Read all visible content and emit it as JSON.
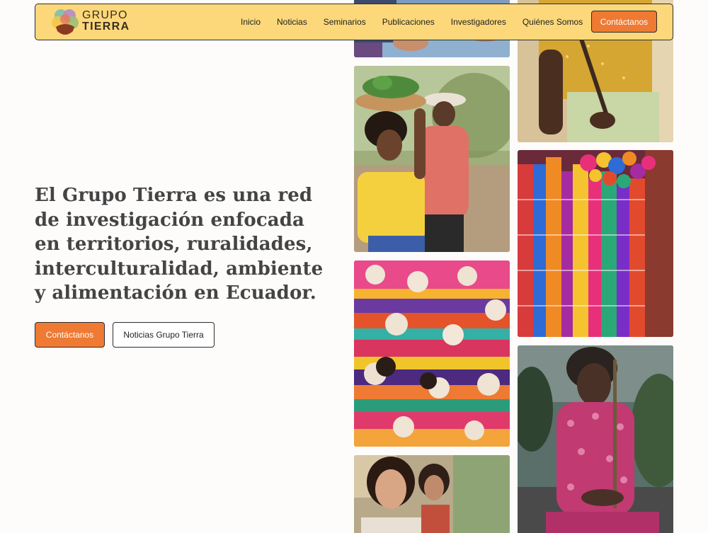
{
  "brand": {
    "name_line1": "GRUPO",
    "name_line2": "TIERRA"
  },
  "nav": {
    "links": [
      "Inicio",
      "Noticias",
      "Seminarios",
      "Publicaciones",
      "Investigadores",
      "Quiénes Somos"
    ],
    "cta_label": "Contáctanos"
  },
  "hero": {
    "title": "El Grupo Tierra es una red de investigación enfocada en territorios, ruralidades, interculturalidad, ambiente y alimentación en Ecuador.",
    "primary_button": "Contáctanos",
    "secondary_button": "Noticias Grupo Tierra"
  },
  "colors": {
    "nav_background": "#fcd87a",
    "accent": "#ef7a33",
    "border": "#2d2d2d",
    "page_background": "#fdfcfb"
  }
}
